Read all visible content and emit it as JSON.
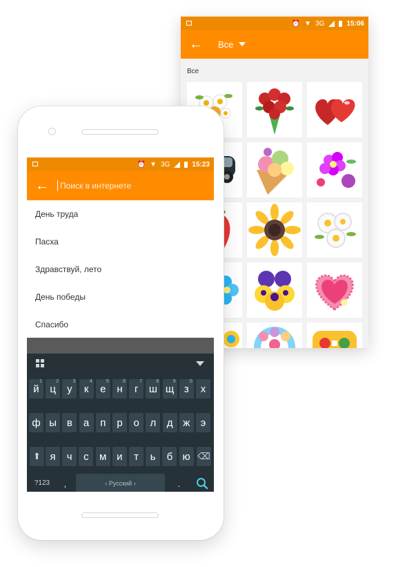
{
  "back_screen": {
    "status_bar": {
      "network": "3G",
      "time": "15:06"
    },
    "toolbar": {
      "back_icon": "arrow-left-icon",
      "title": "Все",
      "dropdown_icon": "triangle-down-icon"
    },
    "section_label": "Все",
    "stickers": [
      {
        "name": "daisy-bouquet"
      },
      {
        "name": "rose-bouquet"
      },
      {
        "name": "two-hearts"
      },
      {
        "name": "car"
      },
      {
        "name": "ice-cream-cone"
      },
      {
        "name": "purple-flowers"
      },
      {
        "name": "strawberry"
      },
      {
        "name": "sunflower"
      },
      {
        "name": "daisies"
      },
      {
        "name": "blue-flower"
      },
      {
        "name": "pansies"
      },
      {
        "name": "lace-heart"
      },
      {
        "name": "sticker-partial"
      },
      {
        "name": "flower-wreath"
      },
      {
        "name": "gamepad"
      }
    ]
  },
  "front_screen": {
    "status_bar": {
      "network": "3G",
      "time": "15:23"
    },
    "toolbar": {
      "back_icon": "arrow-left-icon"
    },
    "search": {
      "placeholder": "Поиск в интернете",
      "value": ""
    },
    "suggestions": [
      "День труда",
      "Пасха",
      "Здравствуй, лето",
      "День победы",
      "Спасибо"
    ],
    "keyboard": {
      "row1": [
        "й",
        "ц",
        "у",
        "к",
        "е",
        "н",
        "г",
        "ш",
        "щ",
        "з",
        "х"
      ],
      "row1_numbers": [
        "1",
        "2",
        "3",
        "4",
        "5",
        "6",
        "7",
        "8",
        "9",
        "0",
        ""
      ],
      "row2": [
        "ф",
        "ы",
        "в",
        "а",
        "п",
        "р",
        "о",
        "л",
        "д",
        "ж",
        "э"
      ],
      "row3": [
        "я",
        "ч",
        "с",
        "м",
        "и",
        "т",
        "ь",
        "б",
        "ю"
      ],
      "shift_icon": "shift-arrow-icon",
      "backspace_icon": "backspace-icon",
      "symbols_label": "?123",
      "comma_label": ",",
      "space_label": "‹ Русский ›",
      "period_label": ".",
      "search_icon": "search-icon",
      "grid_icon": "grid-icon",
      "hide_icon": "chevron-down-icon"
    }
  },
  "colors": {
    "accent": "#ff8c00",
    "keyboard_bg": "#263138",
    "key_bg": "#37474f"
  }
}
